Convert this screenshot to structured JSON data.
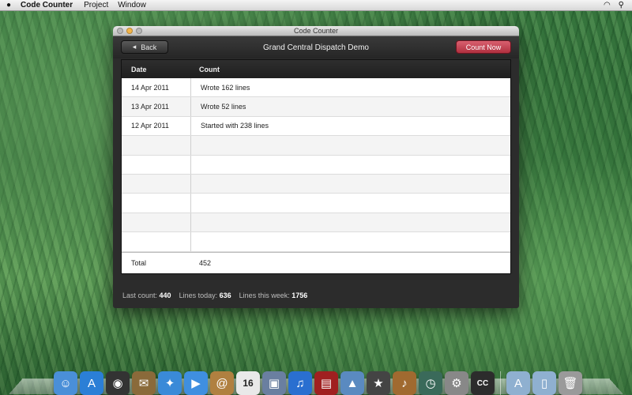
{
  "menubar": {
    "apple": "",
    "app_name": "Code Counter",
    "menus": [
      "Project",
      "Window"
    ],
    "status_icons": [
      "wifi-icon",
      "spotlight-icon"
    ]
  },
  "window": {
    "title": "Code Counter",
    "toolbar": {
      "back_label": "Back",
      "title": "Grand Central Dispatch Demo",
      "count_now_label": "Count Now"
    },
    "table": {
      "headers": {
        "date": "Date",
        "count": "Count"
      },
      "rows": [
        {
          "date": "14 Apr 2011",
          "count": "Wrote 162 lines"
        },
        {
          "date": "13 Apr 2011",
          "count": "Wrote 52 lines"
        },
        {
          "date": "12 Apr 2011",
          "count": "Started with 238 lines"
        },
        {
          "date": "",
          "count": ""
        },
        {
          "date": "",
          "count": ""
        },
        {
          "date": "",
          "count": ""
        },
        {
          "date": "",
          "count": ""
        },
        {
          "date": "",
          "count": ""
        },
        {
          "date": "",
          "count": ""
        }
      ],
      "footer": {
        "label": "Total",
        "value": "452"
      }
    },
    "status": {
      "last_count_label": "Last count:",
      "last_count_value": "440",
      "lines_today_label": "Lines today:",
      "lines_today_value": "636",
      "lines_week_label": "Lines this week:",
      "lines_week_value": "1756"
    }
  },
  "dock": [
    {
      "name": "finder-icon",
      "glyph": "☺",
      "color": "#4a8fd8"
    },
    {
      "name": "app-store-icon",
      "glyph": "A",
      "color": "#2b7fd6"
    },
    {
      "name": "dashboard-icon",
      "glyph": "◉",
      "color": "#333333"
    },
    {
      "name": "mail-stamp-icon",
      "glyph": "✉",
      "color": "#8a6a3a"
    },
    {
      "name": "safari-icon",
      "glyph": "✦",
      "color": "#3a8ad8"
    },
    {
      "name": "facetime-icon",
      "glyph": "▶",
      "color": "#3f8fe0"
    },
    {
      "name": "address-book-icon",
      "glyph": "@",
      "color": "#b08040"
    },
    {
      "name": "calendar-icon",
      "glyph": "16",
      "color": "#e9e9e9"
    },
    {
      "name": "preview-icon",
      "glyph": "▣",
      "color": "#6a7fa0"
    },
    {
      "name": "itunes-icon",
      "glyph": "♫",
      "color": "#2a6fd0"
    },
    {
      "name": "photo-booth-icon",
      "glyph": "▤",
      "color": "#a02020"
    },
    {
      "name": "iphoto-icon",
      "glyph": "▲",
      "color": "#5a8ac0"
    },
    {
      "name": "imovie-icon",
      "glyph": "★",
      "color": "#444444"
    },
    {
      "name": "garageband-icon",
      "glyph": "♪",
      "color": "#a06a30"
    },
    {
      "name": "time-machine-icon",
      "glyph": "◷",
      "color": "#3a6a5a"
    },
    {
      "name": "system-preferences-icon",
      "glyph": "⚙",
      "color": "#888888"
    },
    {
      "name": "code-counter-icon",
      "glyph": "CC",
      "color": "#2c2c2c"
    },
    {
      "name": "applications-folder-icon",
      "glyph": "A",
      "color": "#8fb0d0"
    },
    {
      "name": "documents-folder-icon",
      "glyph": "▯",
      "color": "#8fb0d0"
    },
    {
      "name": "trash-icon",
      "glyph": "🗑",
      "color": "#9a9a9a"
    }
  ]
}
